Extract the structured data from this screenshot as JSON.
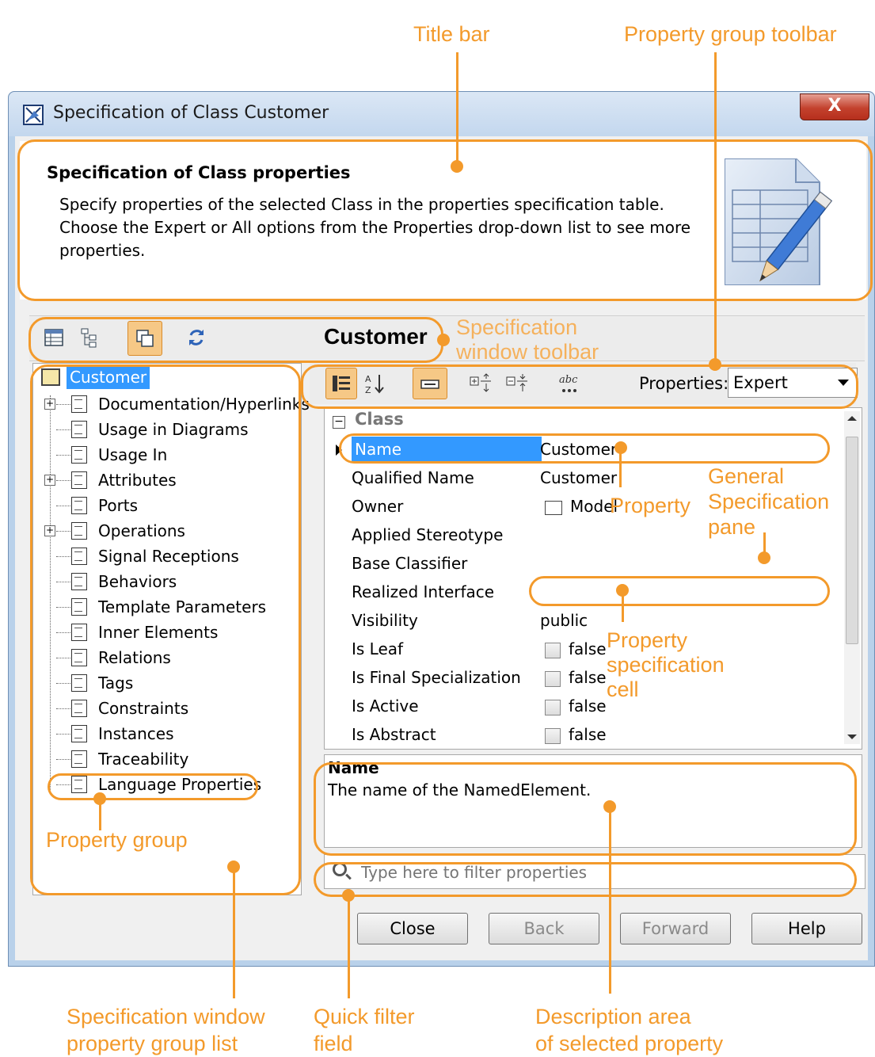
{
  "annotations": {
    "title_bar": "Title bar",
    "property_group_toolbar": "Property group toolbar",
    "specification_window_toolbar": "Specification\nwindow toolbar",
    "property": "Property",
    "general_specification_pane": "General\nSpecification\npane",
    "property_specification_cell": "Property\nspecification\ncell",
    "property_group": "Property group",
    "spec_window_property_group_list": "Specification window\nproperty group list",
    "quick_filter_field": "Quick filter\nfield",
    "description_area": "Description area\nof selected property"
  },
  "window": {
    "title": "Specification of Class Customer",
    "close_label": "X"
  },
  "header": {
    "title": "Specification of Class properties",
    "description": "Specify properties of the selected Class in the properties specification table. Choose the Expert or All options from the Properties drop-down list to see more properties."
  },
  "toolbar": {
    "element_name": "Customer"
  },
  "tree": {
    "root": "Customer",
    "items": [
      {
        "label": "Documentation/Hyperlinks",
        "expandable": true
      },
      {
        "label": "Usage in Diagrams",
        "expandable": false
      },
      {
        "label": "Usage In",
        "expandable": false
      },
      {
        "label": "Attributes",
        "expandable": true
      },
      {
        "label": "Ports",
        "expandable": false
      },
      {
        "label": "Operations",
        "expandable": true
      },
      {
        "label": "Signal Receptions",
        "expandable": false
      },
      {
        "label": "Behaviors",
        "expandable": false
      },
      {
        "label": "Template Parameters",
        "expandable": false
      },
      {
        "label": "Inner Elements",
        "expandable": false
      },
      {
        "label": "Relations",
        "expandable": false
      },
      {
        "label": "Tags",
        "expandable": false
      },
      {
        "label": "Constraints",
        "expandable": false
      },
      {
        "label": "Instances",
        "expandable": false
      },
      {
        "label": "Traceability",
        "expandable": false
      },
      {
        "label": "Language Properties",
        "expandable": false
      }
    ]
  },
  "properties": {
    "label": "Properties:",
    "selected": "Expert",
    "group": "Class",
    "rows": [
      {
        "name": "Name",
        "value": "Customer"
      },
      {
        "name": "Qualified Name",
        "value": "Customer"
      },
      {
        "name": "Owner",
        "value": "Model"
      },
      {
        "name": "Applied Stereotype",
        "value": ""
      },
      {
        "name": "Base Classifier",
        "value": ""
      },
      {
        "name": "Realized Interface",
        "value": ""
      },
      {
        "name": "Visibility",
        "value": "public"
      },
      {
        "name": "Is Leaf",
        "value": "false"
      },
      {
        "name": "Is Final Specialization",
        "value": "false"
      },
      {
        "name": "Is Active",
        "value": "false"
      },
      {
        "name": "Is Abstract",
        "value": "false"
      }
    ]
  },
  "description": {
    "title": "Name",
    "text": "The name of the NamedElement."
  },
  "filter": {
    "placeholder": "Type here to filter properties"
  },
  "buttons": {
    "close": "Close",
    "back": "Back",
    "forward": "Forward",
    "help": "Help"
  },
  "colors": {
    "annotation": "#f39a2b",
    "selection": "#3399ff"
  }
}
